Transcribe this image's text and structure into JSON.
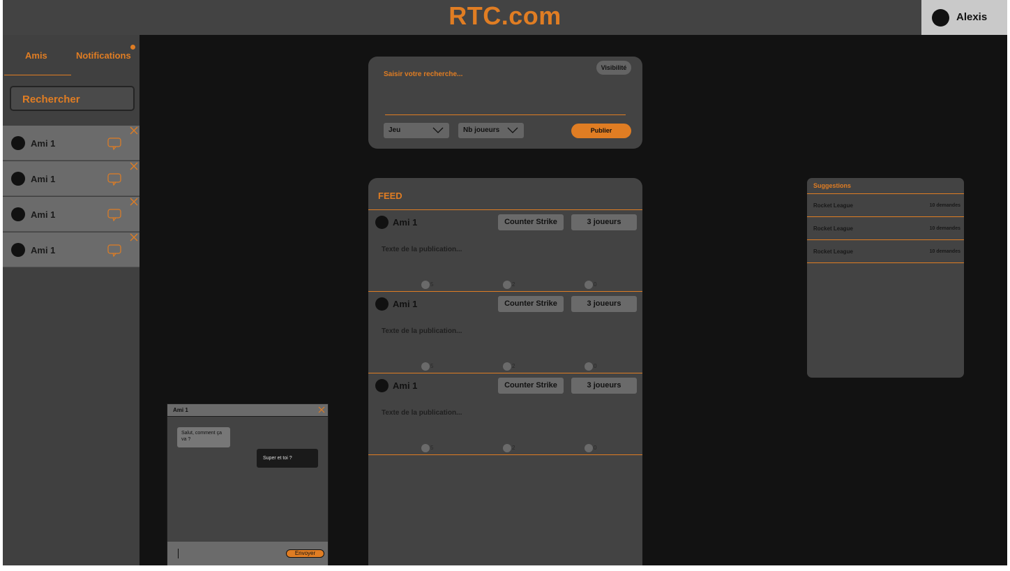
{
  "brand": {
    "logo": "RTC.com",
    "accent": "#e07d23"
  },
  "profile": {
    "name": "Alexis"
  },
  "sidebar": {
    "tabs": [
      {
        "label": "Amis"
      },
      {
        "label": "Notifications"
      }
    ],
    "search_label": "Rechercher",
    "friends": [
      {
        "name": "Ami 1"
      },
      {
        "name": "Ami 1"
      },
      {
        "name": "Ami 1"
      },
      {
        "name": "Ami 1"
      }
    ]
  },
  "publish": {
    "placeholder": "Saisir votre recherche...",
    "visibility_label": "Visibilité",
    "game_select": "Jeu",
    "players_select": "Nb joueurs",
    "publish_label": "Publier"
  },
  "feed": {
    "title": "FEED",
    "posts": [
      {
        "author": "Ami 1",
        "game": "Counter Strike",
        "players": "3 joueurs",
        "text": "Texte de la publication...",
        "reactions": [
          "5",
          "2",
          "0"
        ]
      },
      {
        "author": "Ami 1",
        "game": "Counter Strike",
        "players": "3 joueurs",
        "text": "Texte de la publication...",
        "reactions": [
          "5",
          "2",
          "0"
        ]
      },
      {
        "author": "Ami 1",
        "game": "Counter Strike",
        "players": "3 joueurs",
        "text": "Texte de la publication...",
        "reactions": [
          "5",
          "2",
          "0"
        ]
      }
    ]
  },
  "suggestions": {
    "title": "Suggestions",
    "items": [
      {
        "game": "Rocket League",
        "count": "10 demandes"
      },
      {
        "game": "Rocket League",
        "count": "10 demandes"
      },
      {
        "game": "Rocket League",
        "count": "10 demandes"
      }
    ]
  },
  "chat": {
    "title": "Ami 1",
    "messages": [
      {
        "from": "friend",
        "text": "Salut, comment ça va ?"
      },
      {
        "from": "me",
        "text": "Super et toi ?"
      }
    ],
    "send_label": "Envoyer"
  }
}
